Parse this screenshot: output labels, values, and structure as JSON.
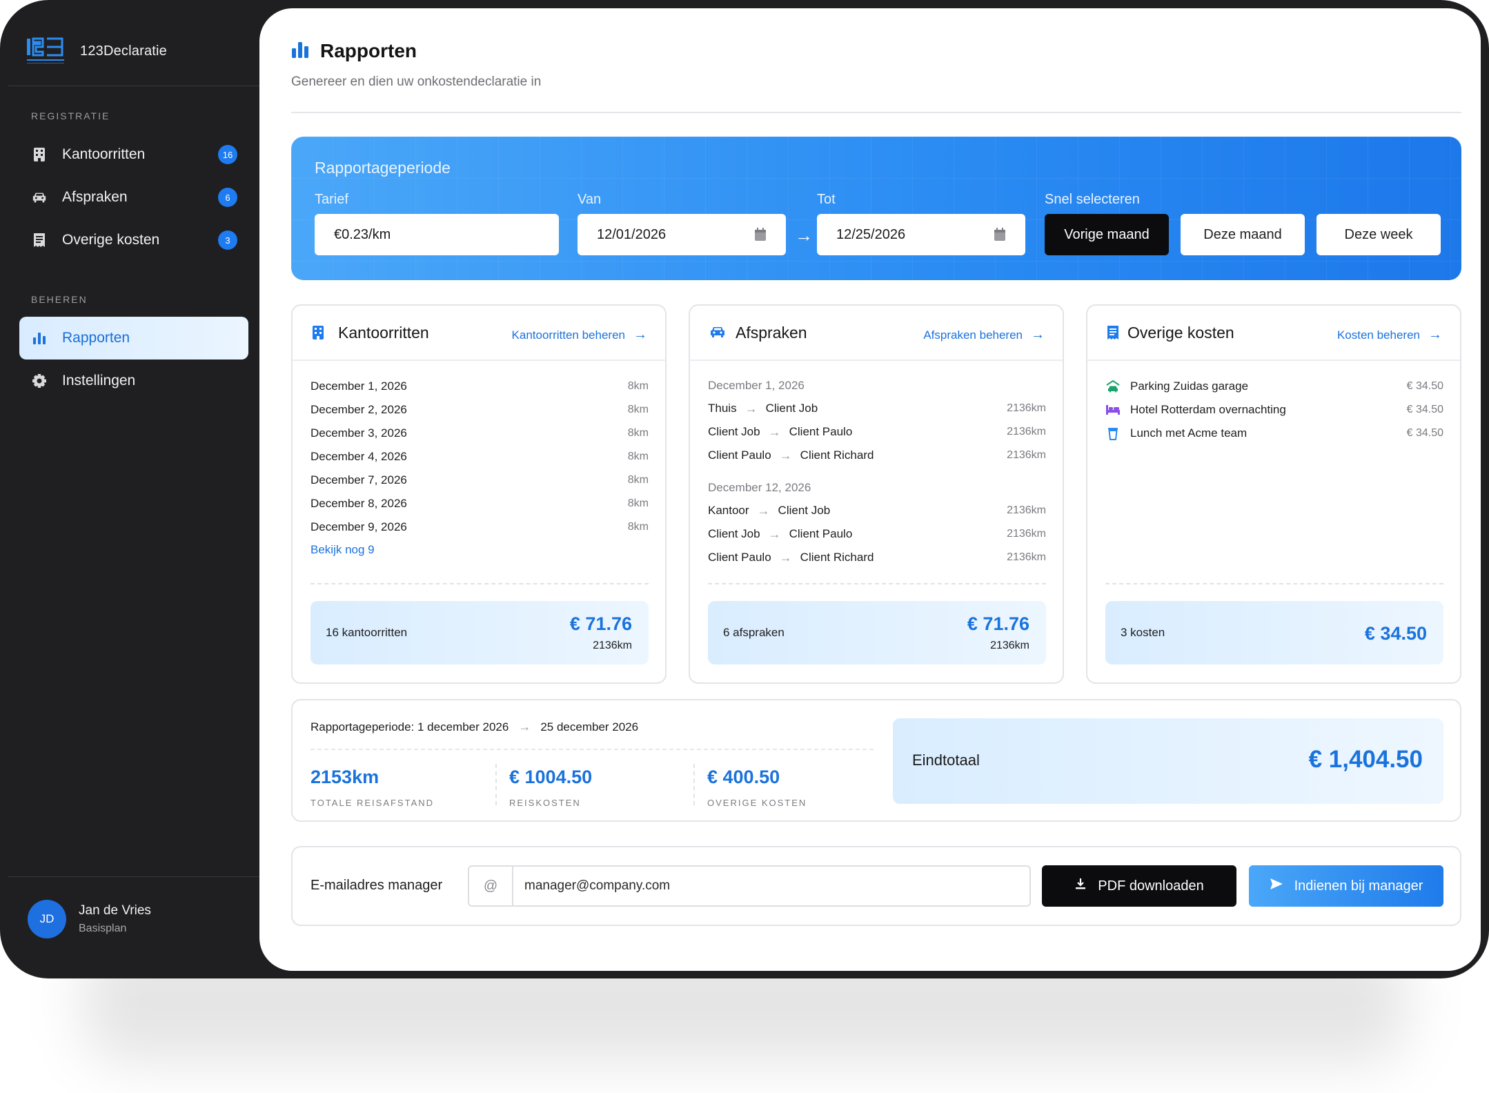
{
  "app": {
    "name": "123Declaratie"
  },
  "sidebar": {
    "section_registratie": "REGISTRATIE",
    "section_beheren": "BEHEREN",
    "items": [
      {
        "label": "Kantoorritten",
        "badge": "16",
        "icon": "building-icon"
      },
      {
        "label": "Afspraken",
        "badge": "6",
        "icon": "car-icon"
      },
      {
        "label": "Overige kosten",
        "badge": "3",
        "icon": "receipt-icon"
      },
      {
        "label": "Rapporten",
        "icon": "bar-chart-icon",
        "active": true
      },
      {
        "label": "Instellingen",
        "icon": "gear-icon"
      }
    ],
    "user": {
      "initials": "JD",
      "name": "Jan de Vries",
      "plan": "Basisplan"
    }
  },
  "header": {
    "title": "Rapporten",
    "subtitle": "Genereer en dien uw onkostendeclaratie in"
  },
  "period": {
    "title": "Rapportageperiode",
    "tarief_label": "Tarief",
    "tarief_value": "€0.23/km",
    "van_label": "Van",
    "van_value": "12/01/2026",
    "tot_label": "Tot",
    "tot_value": "12/25/2026",
    "quick_label": "Snel selecteren",
    "quick": [
      "Vorige maand",
      "Deze maand",
      "Deze week"
    ]
  },
  "cards": {
    "kantoorritten": {
      "title": "Kantoorritten",
      "link": "Kantoorritten beheren",
      "rows": [
        {
          "date": "December 1, 2026",
          "km": "8km"
        },
        {
          "date": "December 2, 2026",
          "km": "8km"
        },
        {
          "date": "December 3, 2026",
          "km": "8km"
        },
        {
          "date": "December 4, 2026",
          "km": "8km"
        },
        {
          "date": "December 7, 2026",
          "km": "8km"
        },
        {
          "date": "December 8, 2026",
          "km": "8km"
        },
        {
          "date": "December 9, 2026",
          "km": "8km"
        }
      ],
      "more": "Bekijk nog 9",
      "count": "16 kantoorritten",
      "amount": "€ 71.76",
      "km": "2136km"
    },
    "afspraken": {
      "title": "Afspraken",
      "link": "Afspraken beheren",
      "groups": [
        {
          "date": "December 1, 2026",
          "rows": [
            {
              "from": "Thuis",
              "to": "Client Job",
              "km": "2136km"
            },
            {
              "from": "Client Job",
              "to": "Client Paulo",
              "km": "2136km"
            },
            {
              "from": "Client Paulo",
              "to": "Client Richard",
              "km": "2136km"
            }
          ]
        },
        {
          "date": "December 12, 2026",
          "rows": [
            {
              "from": "Kantoor",
              "to": "Client Job",
              "km": "2136km"
            },
            {
              "from": "Client Job",
              "to": "Client Paulo",
              "km": "2136km"
            },
            {
              "from": "Client Paulo",
              "to": "Client Richard",
              "km": "2136km"
            }
          ]
        }
      ],
      "count": "6 afspraken",
      "amount": "€ 71.76",
      "km": "2136km"
    },
    "overige": {
      "title": "Overige kosten",
      "link": "Kosten beheren",
      "rows": [
        {
          "label": "Parking Zuidas garage",
          "amount": "€ 34.50",
          "icon": "parking-car-icon",
          "color": "#1aa36b"
        },
        {
          "label": "Hotel Rotterdam overnachting",
          "amount": "€ 34.50",
          "icon": "bed-icon",
          "color": "#8a4fe8"
        },
        {
          "label": "Lunch met Acme team",
          "amount": "€ 34.50",
          "icon": "cup-icon",
          "color": "#2a8cf0"
        }
      ],
      "count": "3 kosten",
      "amount": "€ 34.50"
    }
  },
  "summary": {
    "period_prefix": "Rapportageperiode: 1 december 2026",
    "period_end": "25 december 2026",
    "stats": [
      {
        "value": "2153km",
        "label": "TOTALE REISAFSTAND"
      },
      {
        "value": "€ 1004.50",
        "label": "REISKOSTEN"
      },
      {
        "value": "€ 400.50",
        "label": "OVERIGE KOSTEN"
      }
    ],
    "total_label": "Eindtotaal",
    "total_value": "€ 1,404.50"
  },
  "submit": {
    "email_label": "E-mailadres manager",
    "email_prefix": "@",
    "email_value": "manager@company.com",
    "pdf_button": "PDF downloaden",
    "send_button": "Indienen bij manager"
  },
  "colors": {
    "accent": "#1a72dc",
    "badge": "#1e7bf0",
    "sidebar_bg": "#1f1f21"
  }
}
